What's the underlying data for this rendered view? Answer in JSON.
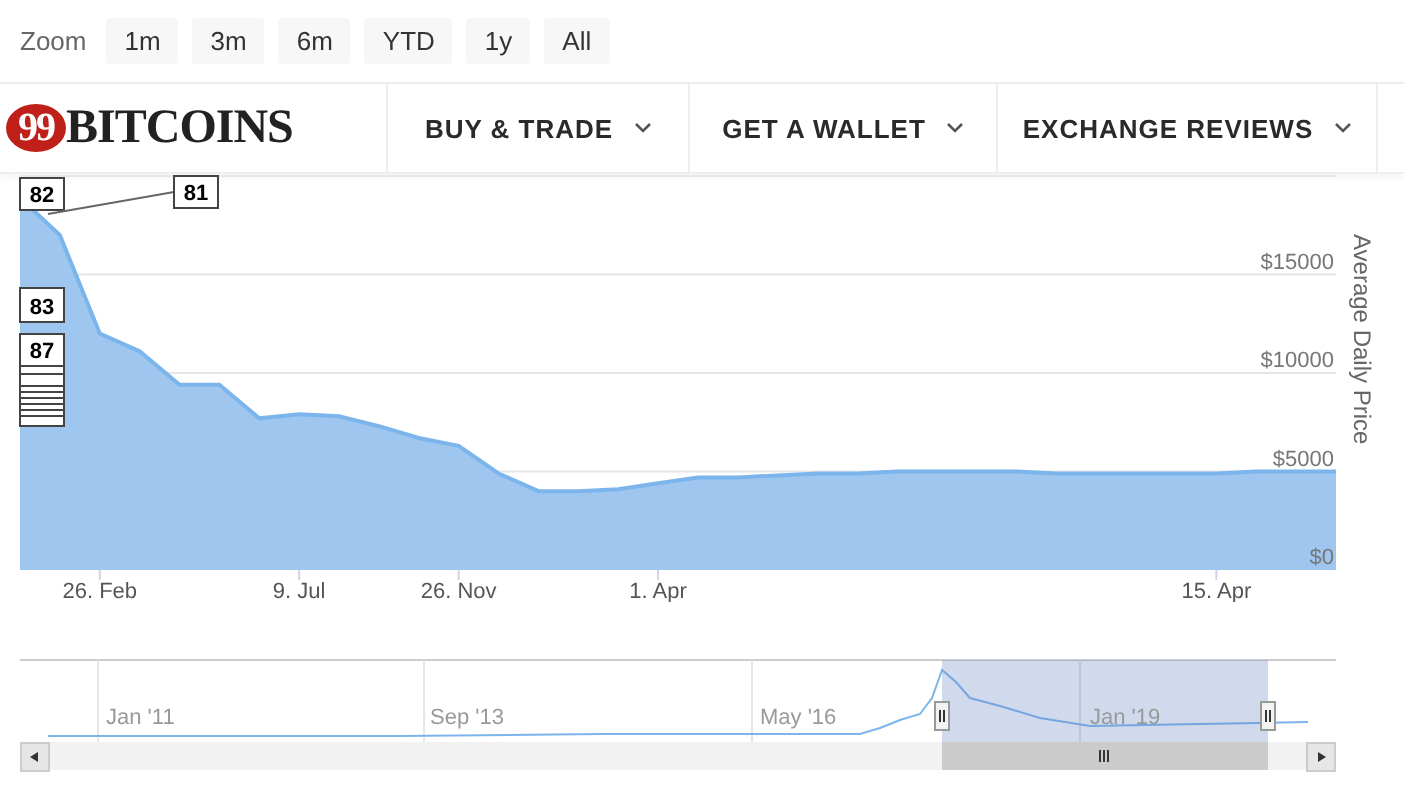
{
  "range_selector": {
    "label": "Zoom",
    "buttons": [
      "1m",
      "3m",
      "6m",
      "YTD",
      "1y",
      "All"
    ]
  },
  "header": {
    "logo": {
      "badge": "99",
      "text": "BITCOINS"
    },
    "menu": [
      "BUY & TRADE",
      "GET A WALLET",
      "EXCHANGE REVIEWS"
    ]
  },
  "chart": {
    "chart_data": {
      "type": "area",
      "ylabel": "Average Daily Price",
      "categories": [
        null,
        null,
        "26. Feb",
        null,
        null,
        null,
        null,
        "9. Jul",
        null,
        null,
        null,
        "26. Nov",
        null,
        null,
        null,
        null,
        "1. Apr",
        null,
        null,
        null,
        null,
        null,
        null,
        null,
        null,
        null,
        null,
        null,
        null,
        null,
        "15. Apr",
        null,
        null,
        null
      ],
      "series": [
        {
          "color": "#7cb5ec",
          "values": [
            18900,
            17000,
            12000,
            11100,
            9400,
            9400,
            7700,
            7900,
            7800,
            7300,
            6700,
            6300,
            4900,
            4000,
            4000,
            4100,
            4400,
            4700,
            4700,
            4800,
            4900,
            4900,
            5000,
            5000,
            5000,
            5000,
            4900,
            4900,
            4900,
            4900,
            4900,
            5000,
            5000,
            5000
          ]
        }
      ],
      "ylim": [
        0,
        20000
      ],
      "grid": true,
      "yticks": [
        {
          "value": 0,
          "label": "$0"
        },
        {
          "value": 5000,
          "label": "$5000"
        },
        {
          "value": 10000,
          "label": "$10000"
        },
        {
          "value": 15000,
          "label": "$15000"
        }
      ],
      "annotations": [
        {
          "text": "82"
        },
        {
          "text": "81"
        },
        {
          "text": "83"
        },
        {
          "text": "87"
        }
      ]
    }
  },
  "navigator": {
    "axis_labels": [
      "Jan '11",
      "Sep '13",
      "May '16",
      "Jan '19"
    ]
  }
}
